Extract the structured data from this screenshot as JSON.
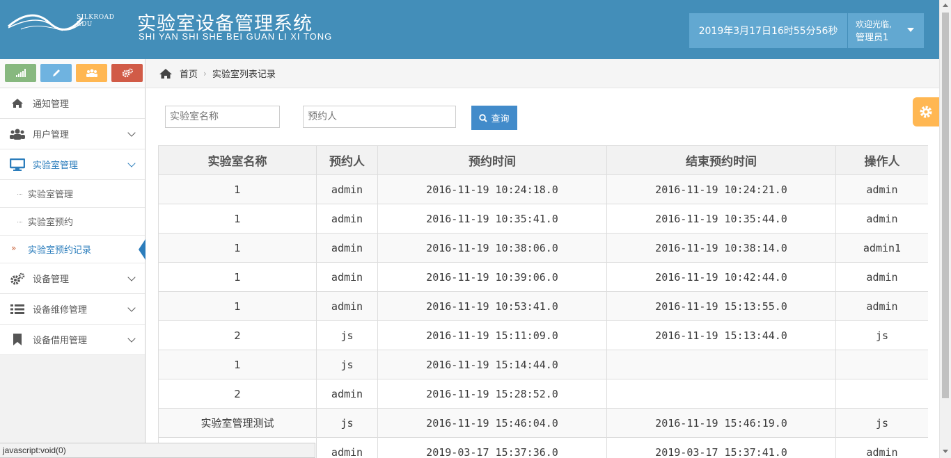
{
  "header": {
    "logo_text": "SILKROAD EDU",
    "title_cn": "实验室设备管理系统",
    "title_en": "SHI YAN SHI SHE BEI GUAN LI XI TONG",
    "datetime": "2019年3月17日16时55分56秒",
    "welcome": "欢迎光临,",
    "username": "管理员1",
    "bg_color": "#438eb9"
  },
  "sidebar": {
    "shortcuts": [
      {
        "icon": "signal-icon",
        "color": "#87b87f"
      },
      {
        "icon": "pencil-icon",
        "color": "#6fb3e0"
      },
      {
        "icon": "users-icon",
        "color": "#ffb752"
      },
      {
        "icon": "cogs-icon",
        "color": "#d15b47"
      }
    ],
    "items": [
      {
        "label": "通知管理",
        "icon": "home-icon"
      },
      {
        "label": "用户管理",
        "icon": "users-icon"
      },
      {
        "label": "实验室管理",
        "icon": "desktop-icon"
      },
      {
        "label": "设备管理",
        "icon": "cogs-icon"
      },
      {
        "label": "设备维修管理",
        "icon": "list-icon"
      },
      {
        "label": "设备借用管理",
        "icon": "bookmark-icon"
      }
    ],
    "lab_subitems": [
      "实验室管理",
      "实验室预约",
      "实验室预约记录"
    ]
  },
  "breadcrumb": {
    "home": "首页",
    "current": "实验室列表记录"
  },
  "search": {
    "name_placeholder": "实验室名称",
    "person_placeholder": "预约人",
    "button_label": "查询"
  },
  "table": {
    "headers": [
      "实验室名称",
      "预约人",
      "预约时间",
      "结束预约时间",
      "操作人"
    ],
    "rows": [
      [
        "1",
        "admin",
        "2016-11-19 10:24:18.0",
        "2016-11-19 10:24:21.0",
        "admin"
      ],
      [
        "1",
        "admin",
        "2016-11-19 10:35:41.0",
        "2016-11-19 10:35:44.0",
        "admin"
      ],
      [
        "1",
        "admin",
        "2016-11-19 10:38:06.0",
        "2016-11-19 10:38:14.0",
        "admin1"
      ],
      [
        "1",
        "admin",
        "2016-11-19 10:39:06.0",
        "2016-11-19 10:42:44.0",
        "admin"
      ],
      [
        "1",
        "admin",
        "2016-11-19 10:53:41.0",
        "2016-11-19 15:13:55.0",
        "admin"
      ],
      [
        "2",
        "js",
        "2016-11-19 15:11:09.0",
        "2016-11-19 15:13:44.0",
        "js"
      ],
      [
        "1",
        "js",
        "2016-11-19 15:14:44.0",
        "",
        ""
      ],
      [
        "2",
        "admin",
        "2016-11-19 15:28:52.0",
        "",
        ""
      ],
      [
        "实验室管理测试",
        "js",
        "2016-11-19 15:46:04.0",
        "2016-11-19 15:46:19.0",
        "js"
      ],
      [
        "",
        "admin",
        "2019-03-17 15:37:36.0",
        "2019-03-17 15:37:41.0",
        "admin"
      ]
    ]
  },
  "statusbar": {
    "text": "javascript:void(0)"
  }
}
